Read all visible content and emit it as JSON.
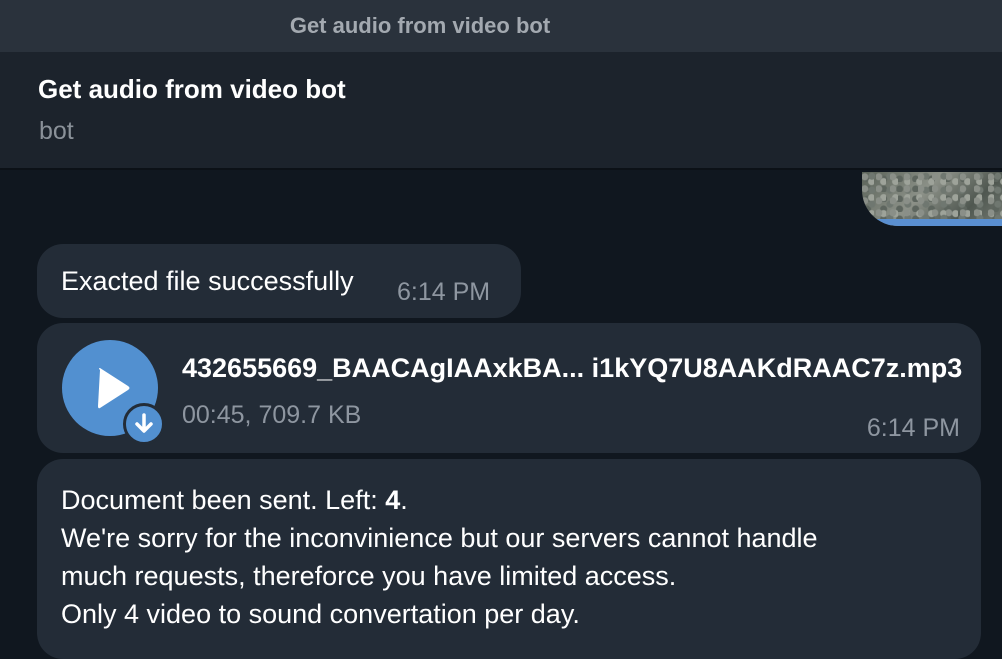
{
  "window": {
    "title": "Get audio from video bot"
  },
  "header": {
    "name": "Get audio from video bot",
    "status": "bot"
  },
  "messages": {
    "m1": {
      "text": "Exacted file successfully",
      "time": "6:14 PM"
    },
    "m2": {
      "file_name": "432655669_BAACAgIAAxkBA... i1kYQ7U8AAKdRAAC7z.mp3",
      "meta": "00:45, 709.7 KB",
      "time": "6:14 PM",
      "play_icon": "play-icon",
      "download_icon": "download-arrow-icon"
    },
    "m3": {
      "line1_prefix": "Document been sent. Left: ",
      "line1_count": "4",
      "line1_suffix": ".",
      "line2": "We're sorry for the inconvinience but our servers cannot handle",
      "line3": "much requests, thereforce you have limited access.",
      "line4": "Only 4 video to sound convertation per day."
    }
  },
  "colors": {
    "background": "#10171f",
    "header": "#1c232c",
    "titlebar": "#2a323c",
    "bubble": "#232c37",
    "accent": "#5290d0"
  }
}
